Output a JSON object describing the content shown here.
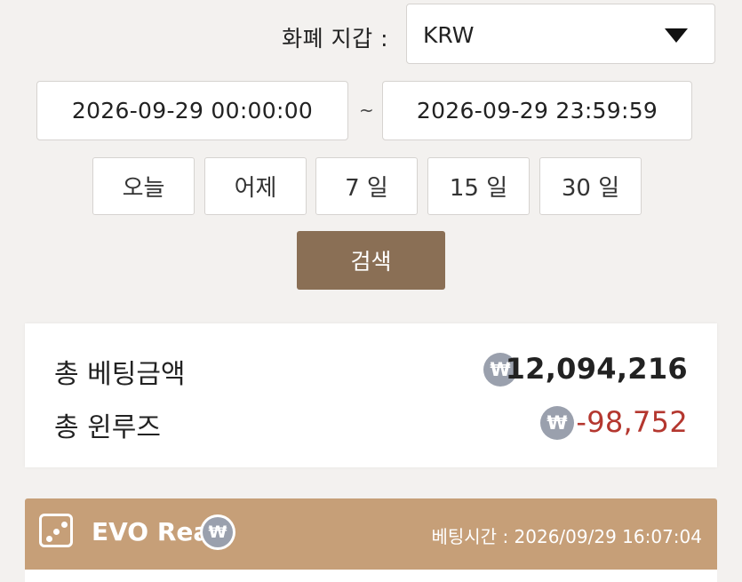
{
  "filter": {
    "currency_label": "화폐 지갑 :",
    "currency_value": "KRW",
    "date_from": "2026-09-29 00:00:00",
    "date_separator": "~",
    "date_to": "2026-09-29 23:59:59",
    "quick_ranges": [
      "오늘",
      "어제",
      "7 일",
      "15 일",
      "30 일"
    ],
    "search_label": "검색"
  },
  "summary": {
    "currency_symbol": "₩",
    "total_bet_label": "총 베팅금액",
    "total_bet_value": "12,094,216",
    "total_winloss_label": "총 윈루즈",
    "total_winloss_value": "-98,752"
  },
  "game_card": {
    "icon": "dice-icon",
    "game_name": "EVO Real",
    "currency_symbol": "₩",
    "bet_time_label": "베팅시간 : 2026/09/29 16:07:04"
  },
  "colors": {
    "background": "#f3f1ef",
    "search_button": "#8a6f55",
    "card_header": "#c69f78",
    "negative_value": "#b4372f",
    "currency_badge": "#9aa0ad"
  }
}
